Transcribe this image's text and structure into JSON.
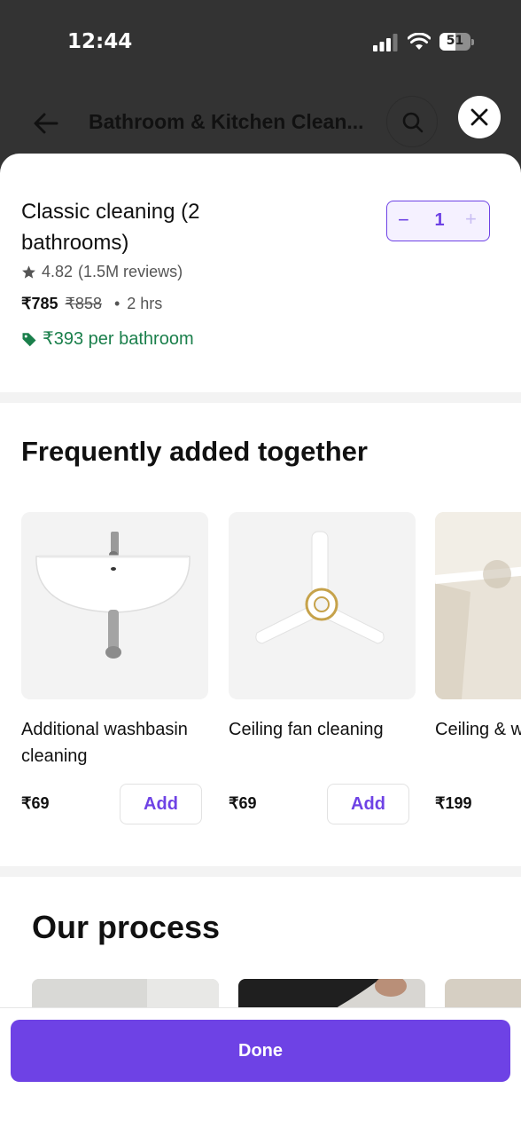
{
  "status_bar": {
    "time": "12:44",
    "battery": "51",
    "battery_level": 0.51
  },
  "header": {
    "title": "Bathroom & Kitchen Clean..."
  },
  "service": {
    "name": "Classic cleaning (2 bathrooms)",
    "rating": "4.82",
    "reviews": "(1.5M reviews)",
    "price": "₹785",
    "original_price": "₹858",
    "separator": "•",
    "duration": "2 hrs",
    "per_unit": "₹393 per bathroom",
    "quantity": "1",
    "minus_label": "−",
    "plus_label": "+"
  },
  "frequently_added": {
    "heading": "Frequently added together",
    "items": [
      {
        "name": "Additional washbasin cleaning",
        "price": "₹69",
        "add_label": "Add"
      },
      {
        "name": "Ceiling fan cleaning",
        "price": "₹69",
        "add_label": "Add"
      },
      {
        "name": "Ceiling & wall cobweb d",
        "price": "₹199"
      }
    ]
  },
  "process": {
    "heading": "Our process"
  },
  "footer": {
    "done_label": "Done"
  },
  "colors": {
    "accent": "#6e42e5",
    "discount_green": "#1a7f4b",
    "dark_overlay": "#333333"
  }
}
